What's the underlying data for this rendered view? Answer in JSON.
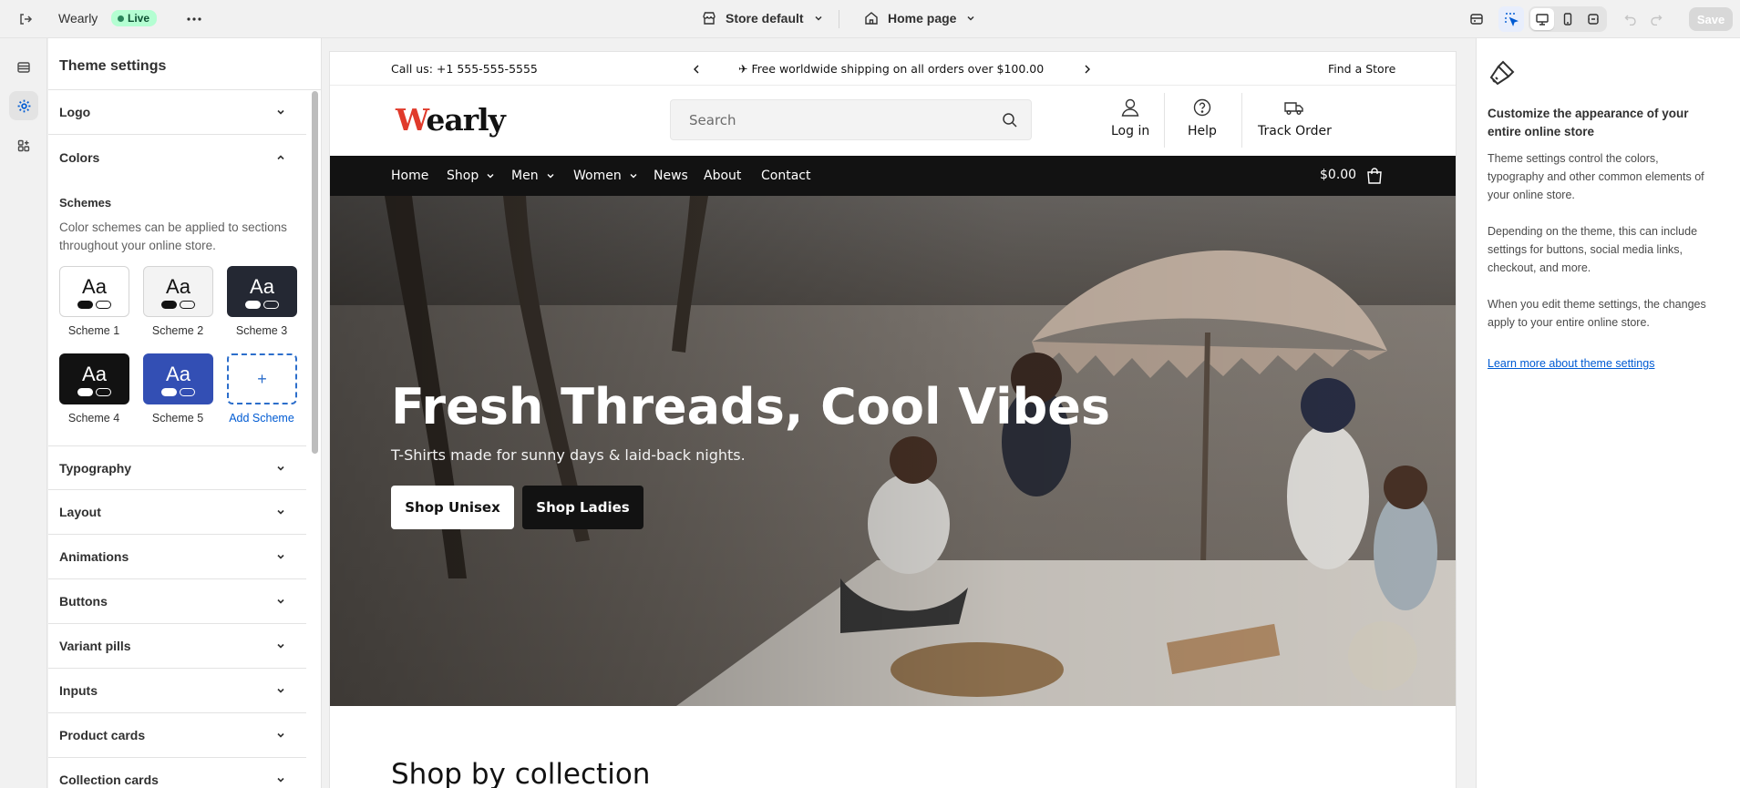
{
  "topbar": {
    "store_name": "Wearly",
    "live_label": "Live",
    "theme_select": "Store default",
    "page_select": "Home page",
    "save_label": "Save"
  },
  "panel": {
    "title": "Theme settings",
    "sections_top": [
      {
        "label": "Logo"
      },
      {
        "label": "Colors"
      }
    ],
    "schemes_title": "Schemes",
    "schemes_desc": "Color schemes can be applied to sections throughout your online store.",
    "schemes": [
      {
        "label": "Scheme 1",
        "bg": "#ffffff",
        "fg": "#121212"
      },
      {
        "label": "Scheme 2",
        "bg": "#f3f3f3",
        "fg": "#121212"
      },
      {
        "label": "Scheme 3",
        "bg": "#242833",
        "fg": "#ffffff"
      },
      {
        "label": "Scheme 4",
        "bg": "#121212",
        "fg": "#ffffff"
      },
      {
        "label": "Scheme 5",
        "bg": "#334fb4",
        "fg": "#ffffff"
      }
    ],
    "add_scheme_label": "Add Scheme",
    "add_scheme_symbol": "+",
    "sections_bottom": [
      {
        "label": "Typography"
      },
      {
        "label": "Layout"
      },
      {
        "label": "Animations"
      },
      {
        "label": "Buttons"
      },
      {
        "label": "Variant pills"
      },
      {
        "label": "Inputs"
      },
      {
        "label": "Product cards"
      },
      {
        "label": "Collection cards"
      }
    ]
  },
  "preview": {
    "announcement": {
      "phone": "Call us: +1 555-555-5555",
      "message": "✈ Free worldwide shipping on all orders over $100.00",
      "store_link": "Find a Store"
    },
    "logo_first": "W",
    "logo_rest": "early",
    "search_placeholder": "Search",
    "header_links": {
      "login": "Log in",
      "help": "Help",
      "track": "Track Order"
    },
    "nav": [
      {
        "label": "Home"
      },
      {
        "label": "Shop"
      },
      {
        "label": "Men"
      },
      {
        "label": "Women"
      },
      {
        "label": "News"
      },
      {
        "label": "About"
      },
      {
        "label": "Contact"
      }
    ],
    "cart_total": "$0.00",
    "hero": {
      "title": "Fresh Threads, Cool Vibes",
      "subtitle": "T-Shirts made for sunny days & laid-back nights.",
      "button_primary": "Shop Unisex",
      "button_secondary": "Shop Ladies"
    },
    "collection_title": "Shop by collection"
  },
  "info": {
    "title": "Customize the appearance of your entire online store",
    "p1": "Theme settings control the colors, typography and other common elements of your online store.",
    "p2": "Depending on the theme, this can include settings for buttons, social media links, checkout, and more.",
    "p3": "When you edit theme settings, the changes apply to your entire online store.",
    "link": "Learn more about theme settings"
  },
  "colors": {
    "accent": "#005bd3",
    "live_badge": "#b4fed2",
    "logo_red": "#e03a2b",
    "nav_bg": "#121212"
  }
}
